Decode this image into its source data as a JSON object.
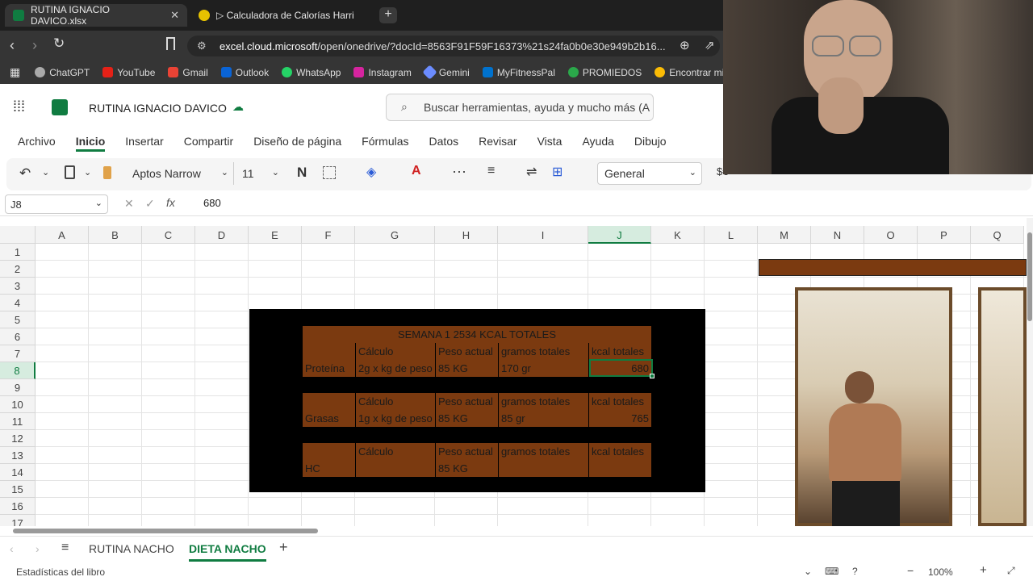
{
  "browser": {
    "tabs": [
      {
        "label": "RUTINA IGNACIO DAVICO.xlsx",
        "active": true
      },
      {
        "label": "▷ Calculadora de Calorías Harris-Bene",
        "active": false
      }
    ],
    "url_domain": "excel.cloud.microsoft",
    "url_rest": "/open/onedrive/?docId=8563F91F59F16373%21s24fa0b0e30e949b2b16...",
    "bookmarks": [
      "ChatGPT",
      "YouTube",
      "Gmail",
      "Outlook",
      "WhatsApp",
      "Instagram",
      "Gemini",
      "MyFitnessPal",
      "PROMIEDOS",
      "Encontrar mi dis"
    ]
  },
  "app": {
    "title": "RUTINA IGNACIO DAVICO",
    "search_placeholder": "Buscar herramientas, ayuda y mucho más (A",
    "menu": [
      "Archivo",
      "Inicio",
      "Insertar",
      "Compartir",
      "Diseño de página",
      "Fórmulas",
      "Datos",
      "Revisar",
      "Vista",
      "Ayuda",
      "Dibujo"
    ],
    "active_menu": "Inicio"
  },
  "ribbon": {
    "font": "Aptos Narrow",
    "size": "11",
    "format": "General"
  },
  "formula_bar": {
    "cell_ref": "J8",
    "value": "680"
  },
  "grid": {
    "columns": [
      "A",
      "B",
      "C",
      "D",
      "E",
      "F",
      "G",
      "H",
      "I",
      "J",
      "K",
      "L",
      "M",
      "N",
      "O",
      "P",
      "Q"
    ],
    "rows": [
      "1",
      "2",
      "3",
      "4",
      "5",
      "6",
      "7",
      "8",
      "9",
      "10",
      "11",
      "12",
      "13",
      "14",
      "15",
      "16",
      "17"
    ],
    "selected_column": "J",
    "selected_row": "8"
  },
  "table": {
    "title": "SEMANA 1 2534 KCAL TOTALES",
    "headers": [
      "Cálculo",
      "Peso actual",
      "gramos totales",
      "kcal totales"
    ],
    "rows": [
      {
        "label": "Proteína",
        "calculo": "2g x kg de peso",
        "peso": "85 KG",
        "gramos": "170 gr",
        "kcal": "680"
      },
      {
        "label": "Grasas",
        "calculo": "1g x kg de peso",
        "peso": "85 KG",
        "gramos": "85 gr",
        "kcal": "765"
      },
      {
        "label": "HC",
        "calculo": "",
        "peso": "85 KG",
        "gramos": "",
        "kcal": ""
      }
    ]
  },
  "sheets": {
    "tabs": [
      "RUTINA NACHO",
      "DIETA NACHO"
    ],
    "active": "DIETA NACHO"
  },
  "status": {
    "left": "Estadísticas del libro",
    "zoom": "100%"
  }
}
